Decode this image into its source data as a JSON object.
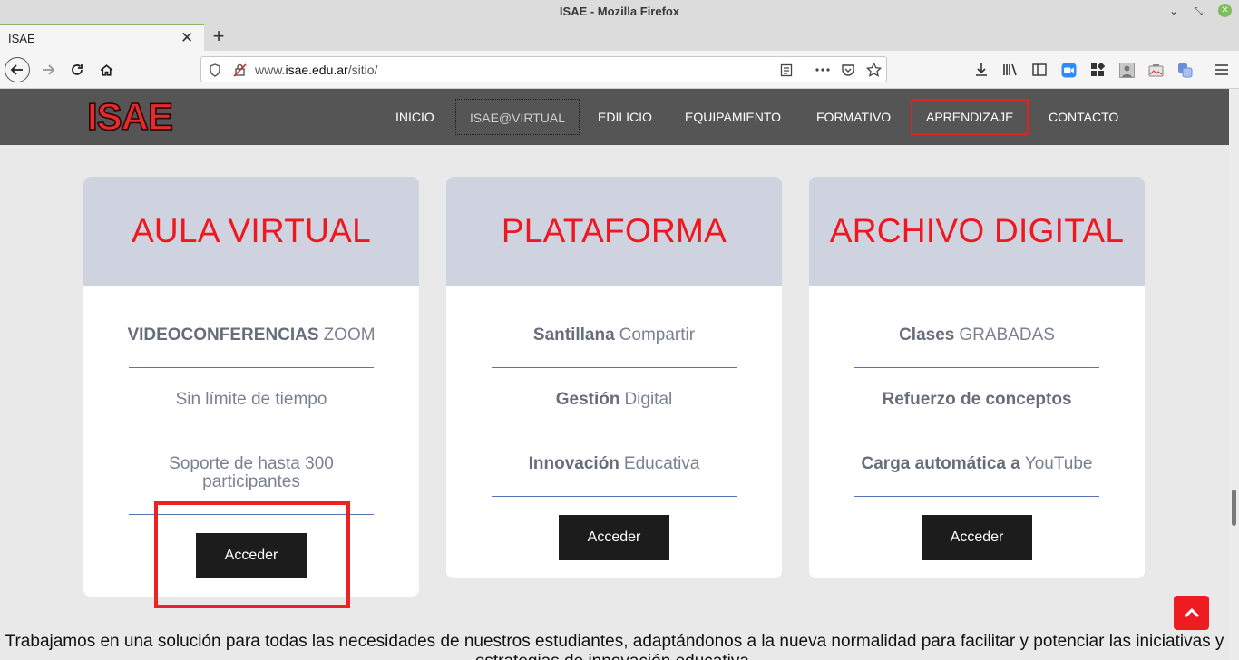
{
  "window": {
    "title": "ISAE - Mozilla Firefox"
  },
  "tab": {
    "label": "ISAE"
  },
  "urlbar": {
    "url_prefix": "www.",
    "url_domain": "isae.edu.ar",
    "url_path": "/sitio/"
  },
  "site": {
    "logo": "ISAE",
    "nav": [
      "INICIO",
      "ISAE@VIRTUAL",
      "EDILICIO",
      "EQUIPAMIENTO",
      "FORMATIVO",
      "APRENDIZAJE",
      "CONTACTO"
    ]
  },
  "cards": [
    {
      "title": "AULA VIRTUAL",
      "features": [
        {
          "bold": "VIDEOCONFERENCIAS",
          "text": "ZOOM"
        },
        {
          "bold": "",
          "text": "Sin límite de tiempo"
        },
        {
          "bold": "",
          "text": "Soporte de hasta 300 participantes"
        }
      ],
      "button": "Acceder"
    },
    {
      "title": "PLATAFORMA",
      "features": [
        {
          "bold": "Santillana",
          "text": "Compartir"
        },
        {
          "bold": "Gestión",
          "text": "Digital"
        },
        {
          "bold": "Innovación",
          "text": "Educativa"
        }
      ],
      "button": "Acceder"
    },
    {
      "title": "ARCHIVO DIGITAL",
      "features": [
        {
          "bold": "Clases",
          "text": "GRABADAS"
        },
        {
          "bold": "Refuerzo de conceptos",
          "text": ""
        },
        {
          "bold": "Carga automática a",
          "text": "YouTube"
        }
      ],
      "button": "Acceder"
    }
  ],
  "bottom_text": "Trabajamos en una solución para todas las necesidades de nuestros estudiantes, adaptándonos a la nueva normalidad para facilitar y potenciar las iniciativas y estrategias de innovación educativa.",
  "colors": {
    "accent": "#f0171f",
    "header_bg": "#555555",
    "card_head_bg": "#cfd3e0",
    "button_bg": "#1c1c1c"
  }
}
